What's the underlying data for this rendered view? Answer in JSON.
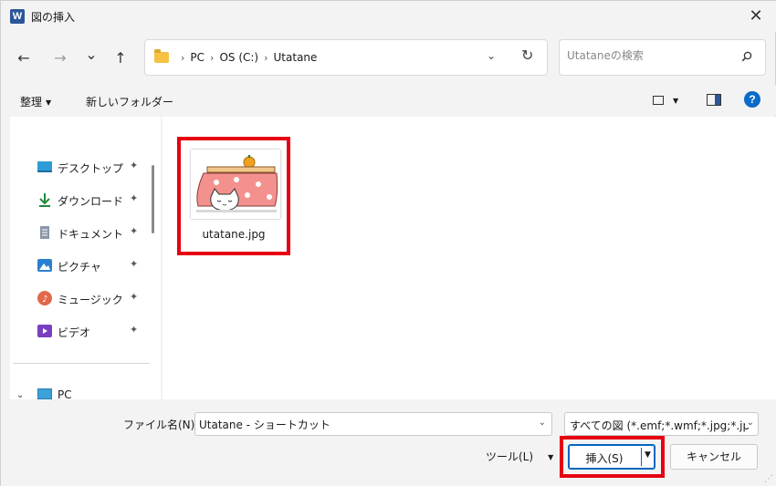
{
  "window": {
    "app_icon_letter": "W",
    "title": "図の挿入",
    "close_glyph": "✕"
  },
  "nav": {
    "back_glyph": "←",
    "forward_glyph": "→",
    "recent_glyph": "⌄",
    "up_glyph": "↑",
    "breadcrumbs": [
      "PC",
      "OS (C:)",
      "Utatane"
    ],
    "separator": "›",
    "address_dropdown_glyph": "⌄",
    "refresh_glyph": "↻",
    "search_placeholder": "Utataneの検索"
  },
  "commandbar": {
    "organize": "整理",
    "new_folder": "新しいフォルダー",
    "help": "?"
  },
  "sidebar": {
    "items": [
      {
        "label": "デスクトップ",
        "icon": "desktop-icon",
        "color": "#2e9bd6"
      },
      {
        "label": "ダウンロード",
        "icon": "download-icon",
        "color": "#1f8a3b"
      },
      {
        "label": "ドキュメント",
        "icon": "documents-icon",
        "color": "#8a96a8"
      },
      {
        "label": "ピクチャ",
        "icon": "pictures-icon",
        "color": "#2b7fd0"
      },
      {
        "label": "ミュージック",
        "icon": "music-icon",
        "color": "#e0694c"
      },
      {
        "label": "ビデオ",
        "icon": "videos-icon",
        "color": "#7a3fbf"
      }
    ],
    "pin_glyph": "📌",
    "pc_label": "PC"
  },
  "content": {
    "files": [
      {
        "name": "utatane.jpg",
        "thumbnail": "kotatsu-cat-image"
      }
    ]
  },
  "footer": {
    "filename_label": "ファイル名(N):",
    "filename_value": "Utatane - ショートカット",
    "filetype_value": "すべての図 (*.emf;*.wmf;*.jpg;*.jp",
    "tools_label": "ツール(L)",
    "insert_label": "挿入(S)",
    "cancel_label": "キャンセル"
  },
  "colors": {
    "highlight": "#e60012",
    "accent": "#0067c0"
  }
}
